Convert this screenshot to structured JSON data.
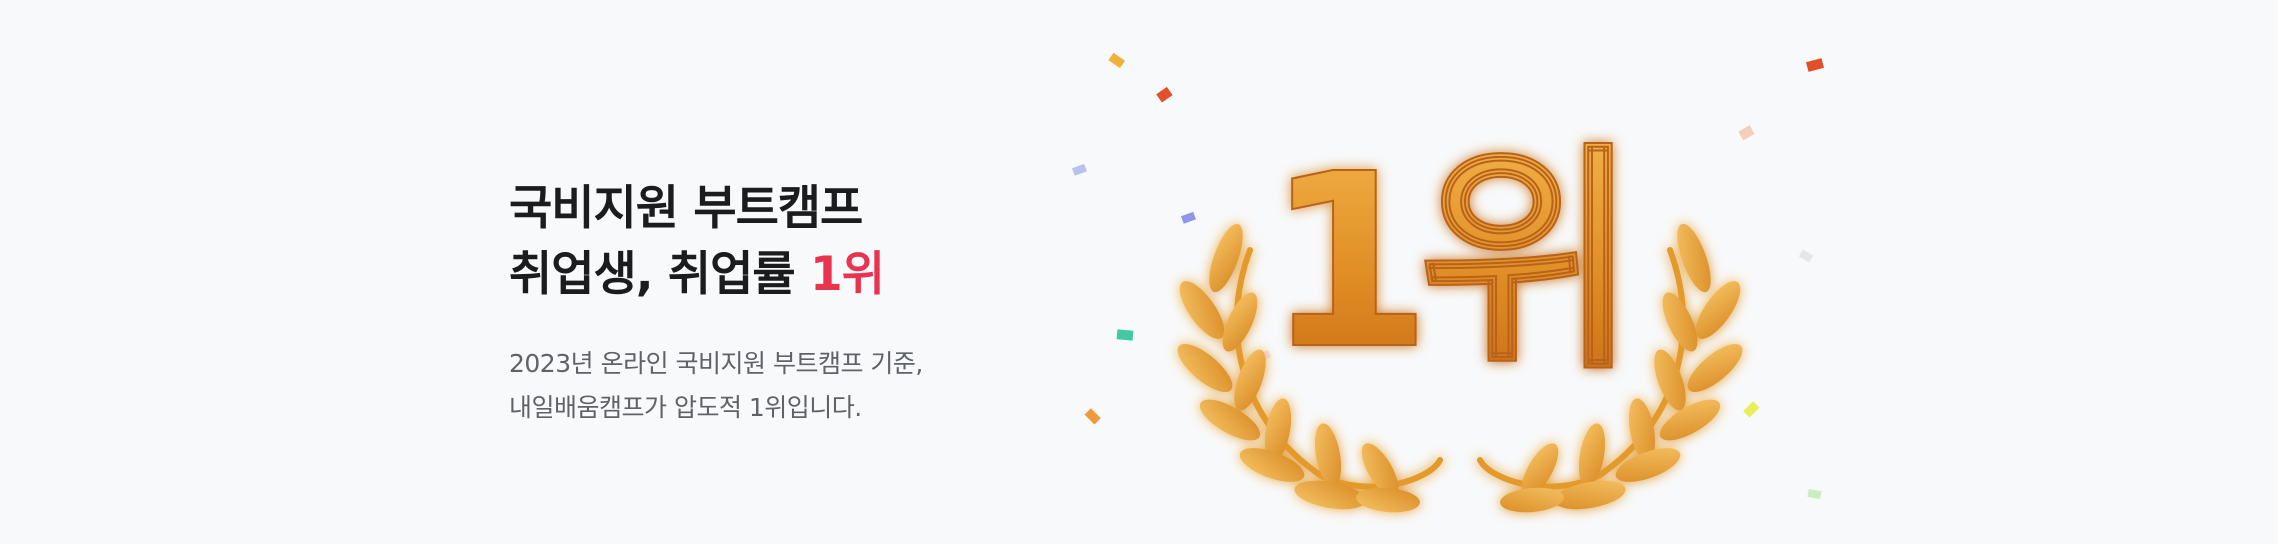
{
  "headline": {
    "line1": "국비지원 부트캠프",
    "line2_prefix": "취업생, 취업률 ",
    "line2_accent": "1위"
  },
  "description": {
    "line1": "2023년 온라인 국비지원 부트캠프 기준,",
    "line2": "내일배움캠프가 압도적 1위입니다."
  },
  "graphic": {
    "badge_text": "1위",
    "icon": "laurel-wreath-icon",
    "accent_color": "#e8344e",
    "gold_color": "#e39a2c"
  }
}
